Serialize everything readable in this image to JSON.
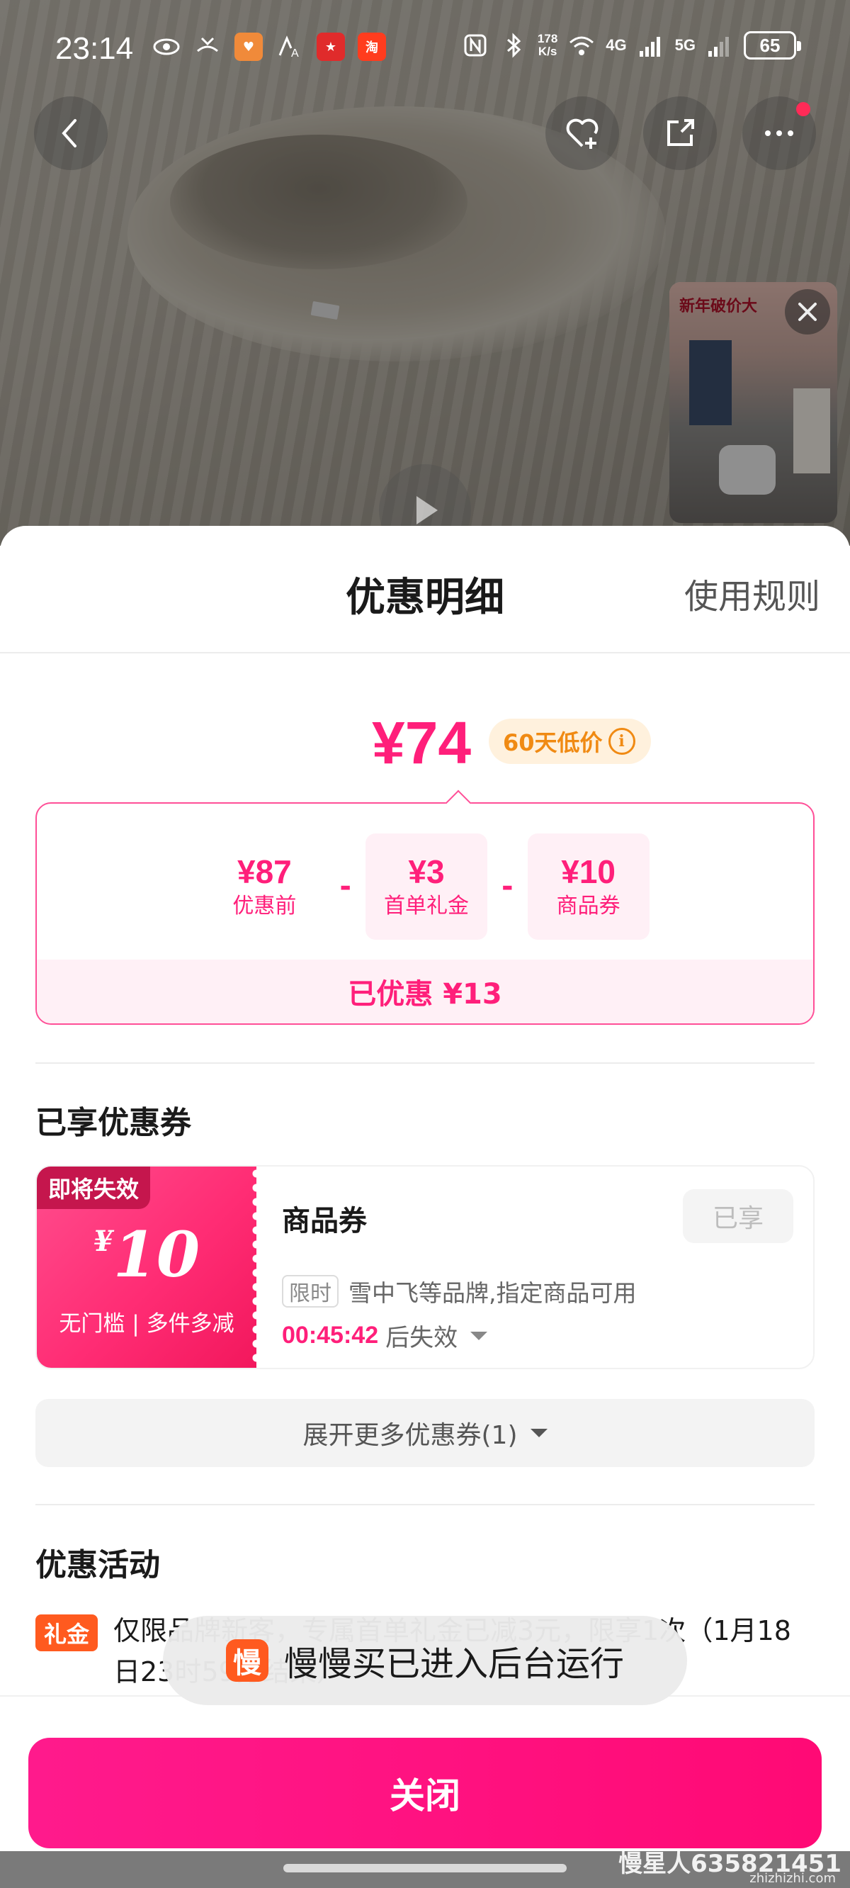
{
  "status_bar": {
    "time": "23:14",
    "net_rate_value": "178",
    "net_rate_unit": "K/s",
    "signal_1": "4G",
    "signal_2": "5G",
    "battery": "65",
    "app_icons": [
      "eye-icon",
      "missed-call-icon",
      "heart-app-icon",
      "font-icon",
      "red-app-icon",
      "taobao-icon"
    ],
    "taobao_label": "淘"
  },
  "product_view": {
    "icons": [
      "back-icon",
      "favorite-add-icon",
      "share-icon",
      "more-icon",
      "play-icon",
      "close-icon"
    ],
    "mini_ad": {
      "title": "新年破价大"
    }
  },
  "sheet": {
    "title": "优惠明细",
    "rules_link": "使用规则",
    "final_price": "¥74",
    "low_price_badge": "60天低价",
    "breakdown": [
      {
        "amount": "¥87",
        "label": "优惠前"
      },
      {
        "amount": "¥3",
        "label": "首单礼金"
      },
      {
        "amount": "¥10",
        "label": "商品券"
      }
    ],
    "operator": "-",
    "saved_label": "已优惠 ¥13",
    "enjoyed_coupons_title": "已享优惠券",
    "coupon": {
      "expire_tag": "即将失效",
      "currency": "¥",
      "value": "10",
      "condition": "无门槛 | 多件多减",
      "name": "商品券",
      "status_button": "已享",
      "limit_tag": "限时",
      "limit_text": "雪中飞等品牌,指定商品可用",
      "countdown": "00:45:42",
      "countdown_suffix": "后失效"
    },
    "expand_more": "展开更多优惠券(1)",
    "activities_title": "优惠活动",
    "activity": {
      "tag": "礼金",
      "text": "仅限品牌新客，专属首单礼金已减3元，限享1次（1月18日23时59分结束）"
    },
    "close_button": "关闭"
  },
  "toast": {
    "logo_char": "慢",
    "text": "慢慢买已进入后台运行"
  },
  "watermark": {
    "text": "慢星人635821451",
    "url": "zhizhizhi.com"
  },
  "colors": {
    "accent": "#ff1f7a",
    "badge_orange": "#f08a13",
    "gift_tag": "#ff5a1f",
    "close_button": "#ff0a75"
  }
}
